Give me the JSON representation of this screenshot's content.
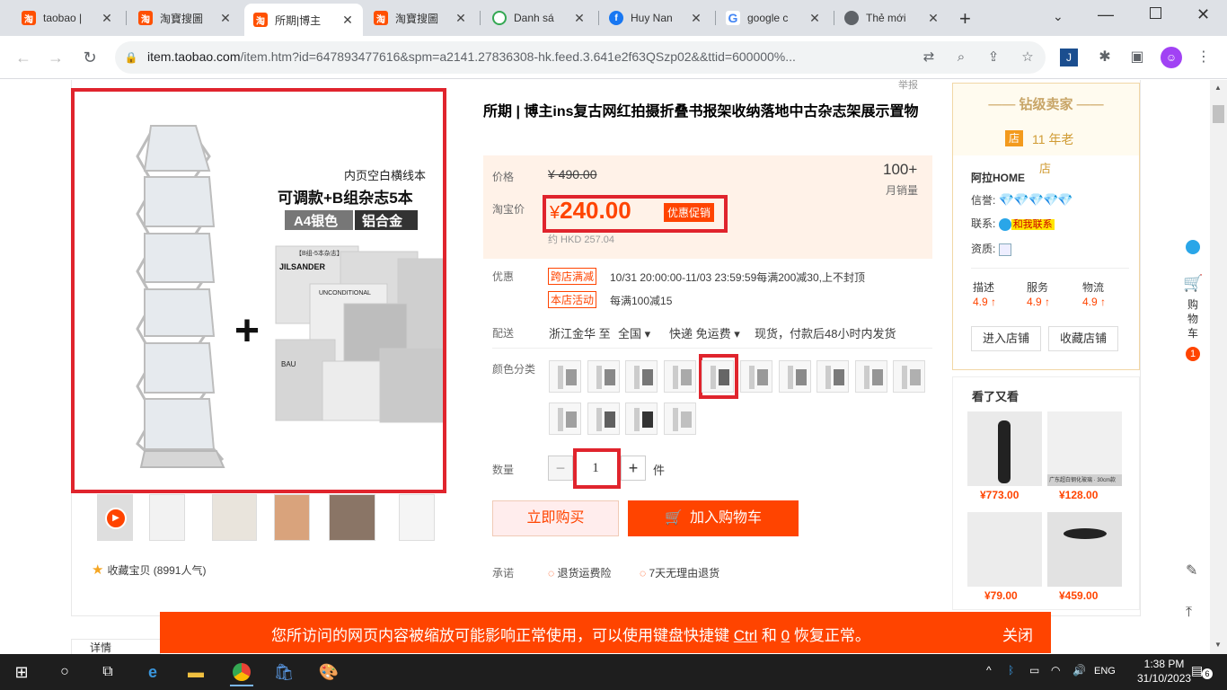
{
  "browser": {
    "tabs": [
      {
        "title": "taobao |",
        "favicon": "taobao-icon",
        "color": "#ff5000"
      },
      {
        "title": "淘寶搜圖",
        "favicon": "taobao-icon",
        "color": "#ff5000"
      },
      {
        "title": "所期|博主",
        "favicon": "taobao-icon",
        "color": "#ff5000",
        "active": true
      },
      {
        "title": "淘寶搜圖",
        "favicon": "taobao-icon",
        "color": "#ff5000"
      },
      {
        "title": "Danh sá",
        "favicon": "sheets-icon",
        "color": "#34a853"
      },
      {
        "title": "Huy Nan",
        "favicon": "facebook-icon",
        "color": "#1877f2"
      },
      {
        "title": "google c",
        "favicon": "google-icon",
        "color": "#4285f4"
      },
      {
        "title": "Thẻ mới",
        "favicon": "chrome-icon",
        "color": "#5f6368"
      }
    ],
    "url_host": "item.taobao.com",
    "url_rest": "/item.htm?id=647893477616&spm=a2141.27836308-hk.feed.3.641e2f63QSzp02&&ttid=600000%..."
  },
  "product": {
    "title": "所期 | 博主ins复古网红拍摄折叠书报架收纳落地中古杂志架展示置物",
    "top_tag": "举报",
    "gallery_overlay": {
      "line1": "内页空白横线本",
      "line2": "可调款+B组杂志5本",
      "tag1": "A4银色",
      "tag2": "铝合金",
      "mag_label": "【B组-5本杂志】",
      "mag_brand": "JILSANDER",
      "mag_title": "UNCONDITIONAL",
      "mag_cover": "BAU",
      "plus": "+"
    },
    "collect_text": "收藏宝贝 (8991人气)",
    "price_label": "价格",
    "old_price": "¥ 490.00",
    "sales_count": "100+",
    "sales_label": "月销量",
    "tb_price_label": "淘宝价",
    "tb_price_currency": "¥",
    "tb_price": "240.00",
    "promo_tag": "优惠促销",
    "hkd_price": "约 HKD 257.04",
    "discount_label": "优惠",
    "coupon1_tag": "跨店满减",
    "coupon1_text": "10/31 20:00:00-11/03 23:59:59每满200减30,上不封顶",
    "coupon2_tag": "本店活动",
    "coupon2_text": "每满100减15",
    "delivery_label": "配送",
    "delivery_from": "浙江金华 至",
    "delivery_to": "全国",
    "delivery_method": "快递 免运费",
    "delivery_note": "现货，付款后48小时内发货",
    "color_label": "颜色分类",
    "qty_label": "数量",
    "qty_minus": "−",
    "qty_value": "1",
    "qty_plus": "+",
    "qty_unit": "件",
    "buy_now": "立即购买",
    "add_to_cart": "加入购物车",
    "promise_label": "承诺",
    "promise1": "退货运费险",
    "promise2": "7天无理由退货"
  },
  "seller": {
    "rank": "钻级卖家",
    "shop_badge": "店",
    "years": "11 年老",
    "years_suffix": "店",
    "name": "阿拉HOME",
    "credit_label": "信誉:",
    "credit_diamonds": "💎💎💎💎💎",
    "contact_label": "联系:",
    "contact_btn": "和我联系",
    "qual_label": "资质:",
    "scores": [
      {
        "label": "描述",
        "value": "4.9 ↑"
      },
      {
        "label": "服务",
        "value": "4.9 ↑"
      },
      {
        "label": "物流",
        "value": "4.9 ↑"
      }
    ],
    "enter_shop": "进入店铺",
    "fav_shop": "收藏店铺",
    "also_viewed": "看了又看",
    "recs": [
      {
        "price": "¥773.00",
        "caption": ""
      },
      {
        "price": "¥128.00",
        "caption": "广东超白钢化玻璃 · 30cm款"
      },
      {
        "price": "¥79.00",
        "caption": ""
      },
      {
        "price": "¥459.00",
        "caption": ""
      }
    ]
  },
  "sidebar": {
    "cart_label": "购物车",
    "cart_count": "1"
  },
  "bottom_tab": "详情",
  "banner": {
    "text_pre": "您所访问的网页内容被缩放可能影响正常使用，可以使用键盘快捷键",
    "key1": "Ctrl",
    "mid": "和",
    "key2": "0",
    "text_post": "恢复正常。",
    "close": "关闭"
  },
  "taskbar": {
    "lang": "ENG",
    "time": "1:38 PM",
    "date": "31/10/2023",
    "notif": "6"
  }
}
